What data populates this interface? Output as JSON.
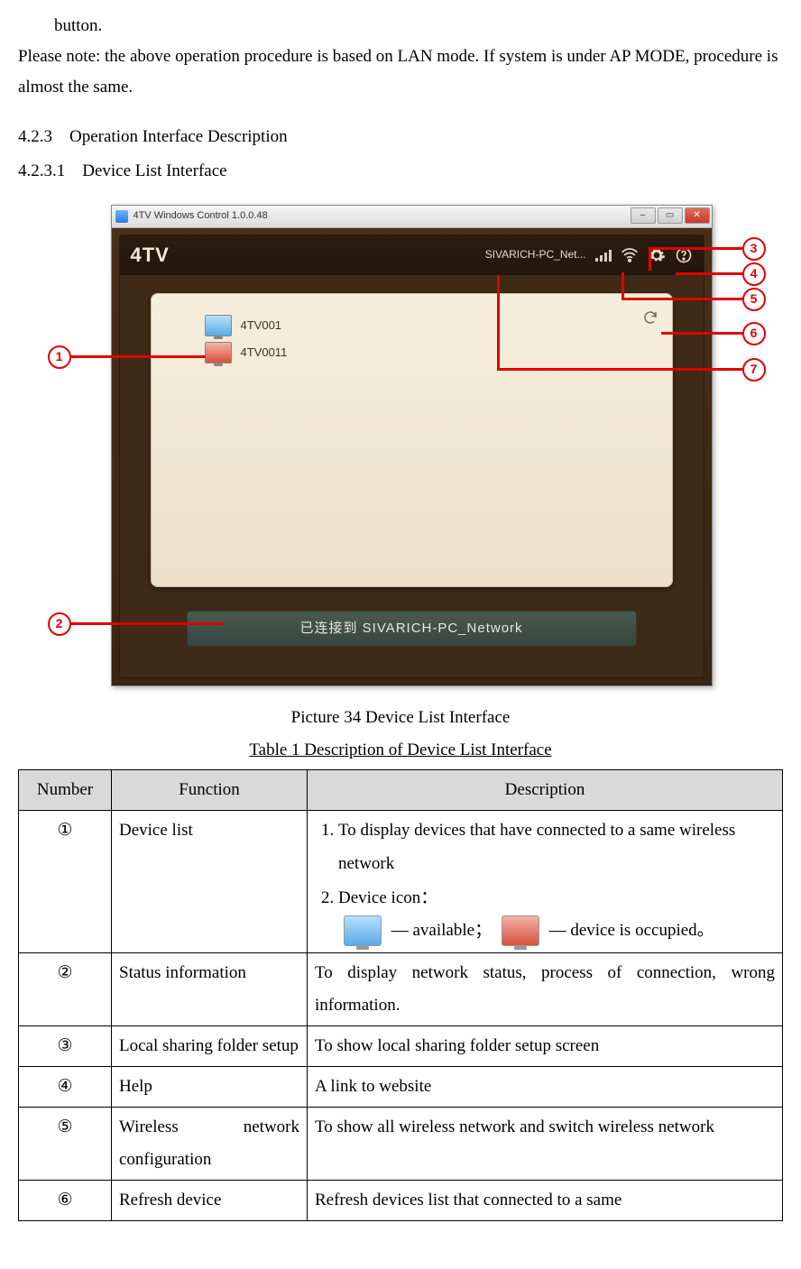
{
  "intro": {
    "line1": "button.",
    "note": "Please note: the above operation procedure is based on LAN mode. If system is under AP MODE, procedure is almost the same."
  },
  "headings": {
    "h423": "4.2.3 Operation Interface Description",
    "h4231": "4.2.3.1 Device List Interface"
  },
  "window": {
    "title": "4TV Windows Control 1.0.0.48",
    "logo": "4TV",
    "ssid": "SIVARICH-PC_Net...",
    "devices": [
      "4TV001",
      "4TV0011"
    ],
    "status": "已连接到 SIVARICH-PC_Network"
  },
  "callouts": {
    "c1": "1",
    "c2": "2",
    "c3": "3",
    "c4": "4",
    "c5": "5",
    "c6": "6",
    "c7": "7"
  },
  "captions": {
    "fig": "Picture 34 Device List Interface",
    "tbl": "Table 1 Description of Device List Interface"
  },
  "table": {
    "headers": {
      "num": "Number",
      "fn": "Function",
      "desc": "Description"
    },
    "rows": [
      {
        "num": "①",
        "fn": "Device list",
        "desc_li1": "To display devices that have connected to a same wireless network",
        "desc_li2_a": "Device icon：",
        "desc_li2_b": " — available； ",
        "desc_li2_c": " — device is occupied。"
      },
      {
        "num": "②",
        "fn": "Status information",
        "desc": "To display network status, process of connection, wrong information."
      },
      {
        "num": "③",
        "fn": "Local sharing folder setup",
        "desc": "To show local sharing folder setup screen"
      },
      {
        "num": "④",
        "fn": "Help",
        "desc": "A link to website"
      },
      {
        "num": "⑤",
        "fn": "Wireless network configuration",
        "desc": "To show all wireless network and switch wireless network"
      },
      {
        "num": "⑥",
        "fn": "Refresh device",
        "desc": "Refresh devices list that connected to a same"
      }
    ]
  }
}
